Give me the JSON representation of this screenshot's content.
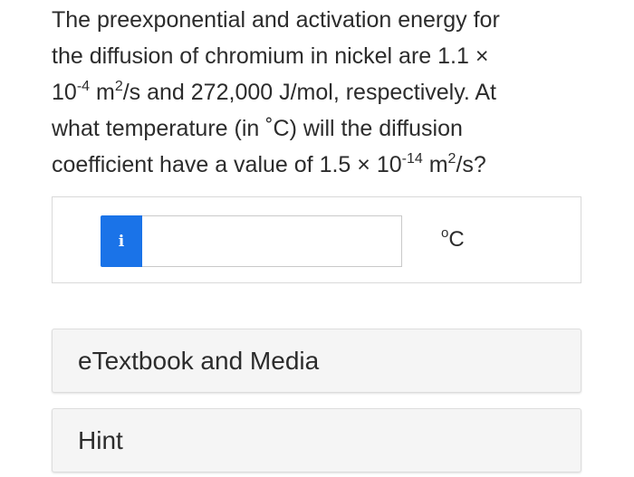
{
  "question": {
    "line1": "The preexponential and activation energy for",
    "line2": "the diffusion of chromium in nickel are 1.1 ×",
    "line3_base": "10",
    "line3_exp": "-4",
    "line3_unit_base": " m",
    "line3_unit_exp": "2",
    "line3_rest": "/s and 272,000 J/mol, respectively. At",
    "line4": "what temperature (in ˚C) will the diffusion",
    "line5_pre": "coefficient have a value of 1.5 × 10",
    "line5_exp": "-14",
    "line5_unit_base": " m",
    "line5_unit_exp": "2",
    "line5_rest": "/s?"
  },
  "answer": {
    "info_label": "i",
    "input_value": "",
    "unit_sup": "o",
    "unit_base": "C"
  },
  "resources": {
    "etextbook_label": "eTextbook and Media",
    "hint_label": "Hint"
  },
  "colors": {
    "info_button": "#1a73e8"
  }
}
